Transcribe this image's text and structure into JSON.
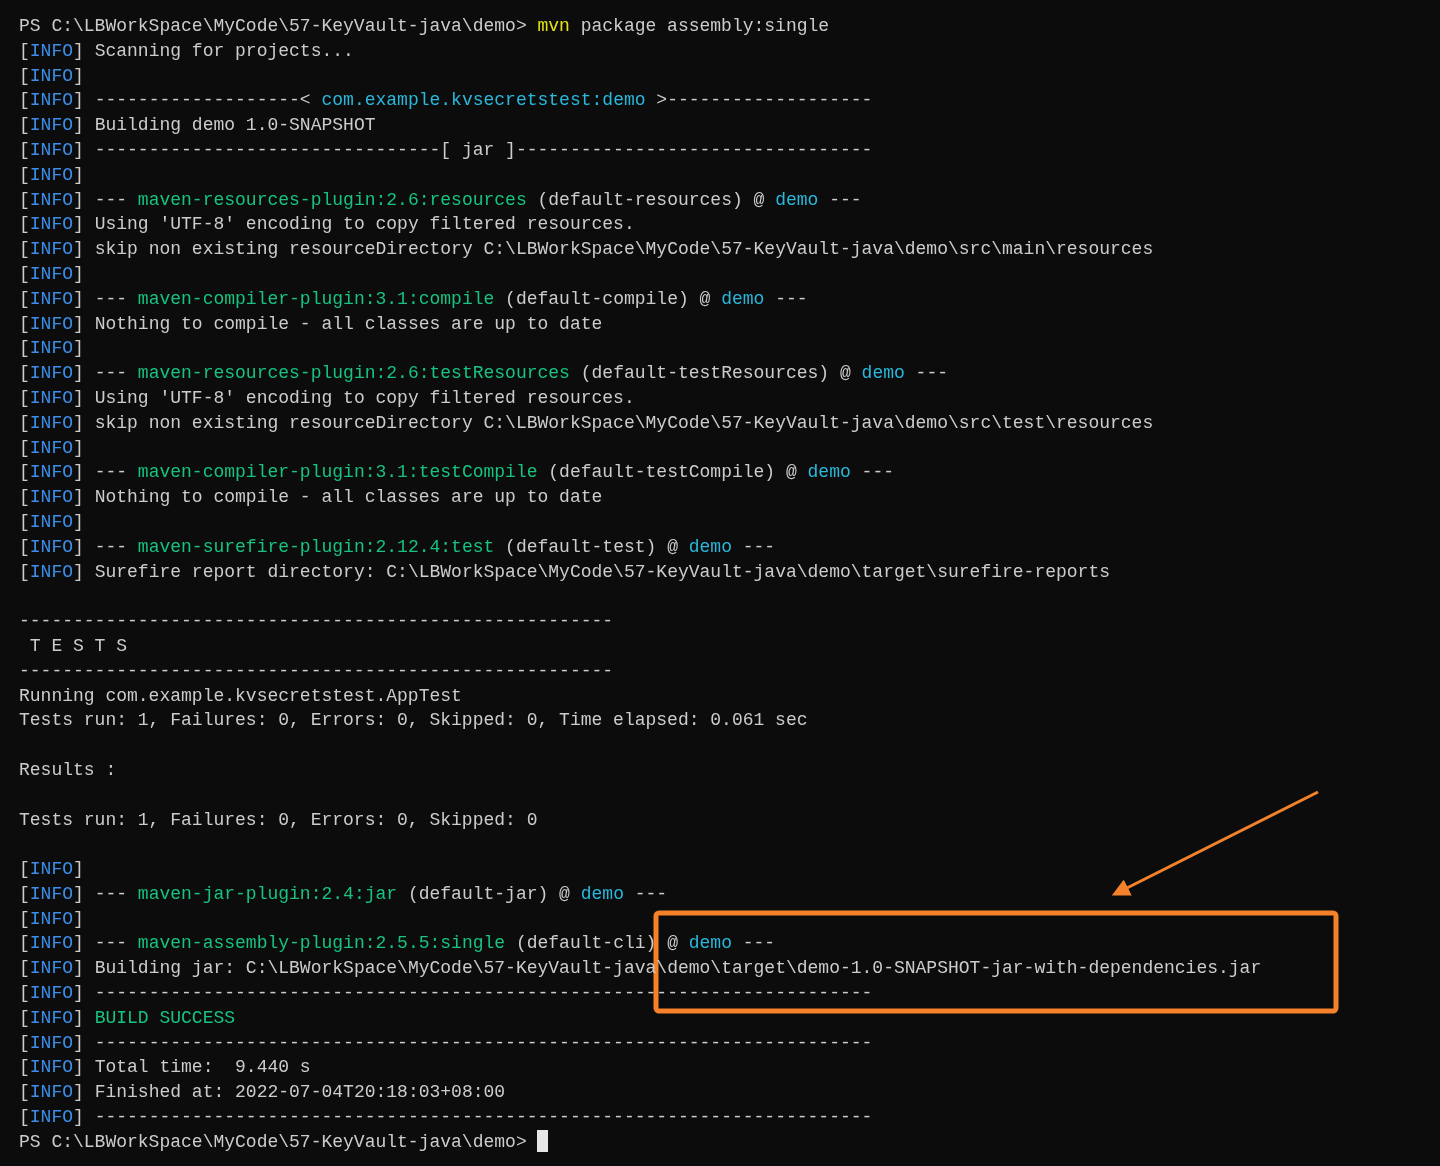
{
  "terminal": {
    "cursor": true,
    "blocks": [
      [
        [
          {
            "text": "PS C:\\LBWorkSpace\\MyCode\\57-KeyVault-java\\demo> ",
            "kind": "plain"
          },
          {
            "text": "mvn",
            "kind": "command"
          },
          {
            "text": " package assembly:single",
            "kind": "plain"
          }
        ],
        [
          {
            "text": "[",
            "kind": "plain"
          },
          {
            "text": "INFO",
            "kind": "tag"
          },
          {
            "text": "] Scanning for projects...",
            "kind": "plain"
          }
        ],
        [
          {
            "text": "[",
            "kind": "plain"
          },
          {
            "text": "INFO",
            "kind": "tag"
          },
          {
            "text": "]",
            "kind": "plain"
          }
        ],
        [
          {
            "text": "[",
            "kind": "plain"
          },
          {
            "text": "INFO",
            "kind": "tag"
          },
          {
            "text": "] -------------------< ",
            "kind": "plain"
          },
          {
            "text": "com.example.kvsecretstest:demo",
            "kind": "project"
          },
          {
            "text": " >-------------------",
            "kind": "plain"
          }
        ],
        [
          {
            "text": "[",
            "kind": "plain"
          },
          {
            "text": "INFO",
            "kind": "tag"
          },
          {
            "text": "] Building demo 1.0-SNAPSHOT",
            "kind": "plain"
          }
        ],
        [
          {
            "text": "[",
            "kind": "plain"
          },
          {
            "text": "INFO",
            "kind": "tag"
          },
          {
            "text": "] --------------------------------[ jar ]---------------------------------",
            "kind": "plain"
          }
        ],
        [
          {
            "text": "[",
            "kind": "plain"
          },
          {
            "text": "INFO",
            "kind": "tag"
          },
          {
            "text": "]",
            "kind": "plain"
          }
        ],
        [
          {
            "text": "[",
            "kind": "plain"
          },
          {
            "text": "INFO",
            "kind": "tag"
          },
          {
            "text": "] --- ",
            "kind": "plain"
          },
          {
            "text": "maven-resources-plugin:2.6:resources",
            "kind": "plugin"
          },
          {
            "text": " (default-resources) @ ",
            "kind": "plain"
          },
          {
            "text": "demo",
            "kind": "project"
          },
          {
            "text": " ---",
            "kind": "plain"
          }
        ],
        [
          {
            "text": "[",
            "kind": "plain"
          },
          {
            "text": "INFO",
            "kind": "tag"
          },
          {
            "text": "] Using 'UTF-8' encoding to copy filtered resources.",
            "kind": "plain"
          }
        ],
        [
          {
            "text": "[",
            "kind": "plain"
          },
          {
            "text": "INFO",
            "kind": "tag"
          },
          {
            "text": "] skip non existing resourceDirectory C:\\LBWorkSpace\\MyCode\\57-KeyVault-java\\demo\\src\\main\\resources",
            "kind": "plain"
          }
        ],
        [
          {
            "text": "[",
            "kind": "plain"
          },
          {
            "text": "INFO",
            "kind": "tag"
          },
          {
            "text": "]",
            "kind": "plain"
          }
        ],
        [
          {
            "text": "[",
            "kind": "plain"
          },
          {
            "text": "INFO",
            "kind": "tag"
          },
          {
            "text": "] --- ",
            "kind": "plain"
          },
          {
            "text": "maven-compiler-plugin:3.1:compile",
            "kind": "plugin"
          },
          {
            "text": " (default-compile) @ ",
            "kind": "plain"
          },
          {
            "text": "demo",
            "kind": "project"
          },
          {
            "text": " ---",
            "kind": "plain"
          }
        ],
        [
          {
            "text": "[",
            "kind": "plain"
          },
          {
            "text": "INFO",
            "kind": "tag"
          },
          {
            "text": "] Nothing to compile - all classes are up to date",
            "kind": "plain"
          }
        ],
        [
          {
            "text": "[",
            "kind": "plain"
          },
          {
            "text": "INFO",
            "kind": "tag"
          },
          {
            "text": "]",
            "kind": "plain"
          }
        ],
        [
          {
            "text": "[",
            "kind": "plain"
          },
          {
            "text": "INFO",
            "kind": "tag"
          },
          {
            "text": "] --- ",
            "kind": "plain"
          },
          {
            "text": "maven-resources-plugin:2.6:testResources",
            "kind": "plugin"
          },
          {
            "text": " (default-testResources) @ ",
            "kind": "plain"
          },
          {
            "text": "demo",
            "kind": "project"
          },
          {
            "text": " ---",
            "kind": "plain"
          }
        ],
        [
          {
            "text": "[",
            "kind": "plain"
          },
          {
            "text": "INFO",
            "kind": "tag"
          },
          {
            "text": "] Using 'UTF-8' encoding to copy filtered resources.",
            "kind": "plain"
          }
        ],
        [
          {
            "text": "[",
            "kind": "plain"
          },
          {
            "text": "INFO",
            "kind": "tag"
          },
          {
            "text": "] skip non existing resourceDirectory C:\\LBWorkSpace\\MyCode\\57-KeyVault-java\\demo\\src\\test\\resources",
            "kind": "plain"
          }
        ],
        [
          {
            "text": "[",
            "kind": "plain"
          },
          {
            "text": "INFO",
            "kind": "tag"
          },
          {
            "text": "]",
            "kind": "plain"
          }
        ],
        [
          {
            "text": "[",
            "kind": "plain"
          },
          {
            "text": "INFO",
            "kind": "tag"
          },
          {
            "text": "] --- ",
            "kind": "plain"
          },
          {
            "text": "maven-compiler-plugin:3.1:testCompile",
            "kind": "plugin"
          },
          {
            "text": " (default-testCompile) @ ",
            "kind": "plain"
          },
          {
            "text": "demo",
            "kind": "project"
          },
          {
            "text": " ---",
            "kind": "plain"
          }
        ],
        [
          {
            "text": "[",
            "kind": "plain"
          },
          {
            "text": "INFO",
            "kind": "tag"
          },
          {
            "text": "] Nothing to compile - all classes are up to date",
            "kind": "plain"
          }
        ],
        [
          {
            "text": "[",
            "kind": "plain"
          },
          {
            "text": "INFO",
            "kind": "tag"
          },
          {
            "text": "]",
            "kind": "plain"
          }
        ],
        [
          {
            "text": "[",
            "kind": "plain"
          },
          {
            "text": "INFO",
            "kind": "tag"
          },
          {
            "text": "] --- ",
            "kind": "plain"
          },
          {
            "text": "maven-surefire-plugin:2.12.4:test",
            "kind": "plugin"
          },
          {
            "text": " (default-test) @ ",
            "kind": "plain"
          },
          {
            "text": "demo",
            "kind": "project"
          },
          {
            "text": " ---",
            "kind": "plain"
          }
        ],
        [
          {
            "text": "[",
            "kind": "plain"
          },
          {
            "text": "INFO",
            "kind": "tag"
          },
          {
            "text": "] Surefire report directory: C:\\LBWorkSpace\\MyCode\\57-KeyVault-java\\demo\\target\\surefire-reports",
            "kind": "plain"
          }
        ]
      ],
      [
        [
          {
            "text": "-------------------------------------------------------",
            "kind": "plain"
          }
        ],
        [
          {
            "text": " T E S T S",
            "kind": "plain"
          }
        ],
        [
          {
            "text": "-------------------------------------------------------",
            "kind": "plain"
          }
        ],
        [
          {
            "text": "Running com.example.kvsecretstest.AppTest",
            "kind": "plain"
          }
        ],
        [
          {
            "text": "Tests run: 1, Failures: 0, Errors: 0, Skipped: 0, Time elapsed: 0.061 sec",
            "kind": "plain"
          }
        ]
      ],
      [
        [
          {
            "text": "Results :",
            "kind": "plain"
          }
        ]
      ],
      [
        [
          {
            "text": "Tests run: 1, Failures: 0, Errors: 0, Skipped: 0",
            "kind": "plain"
          }
        ]
      ],
      [
        [
          {
            "text": "[",
            "kind": "plain"
          },
          {
            "text": "INFO",
            "kind": "tag"
          },
          {
            "text": "]",
            "kind": "plain"
          }
        ],
        [
          {
            "text": "[",
            "kind": "plain"
          },
          {
            "text": "INFO",
            "kind": "tag"
          },
          {
            "text": "] --- ",
            "kind": "plain"
          },
          {
            "text": "maven-jar-plugin:2.4:jar",
            "kind": "plugin"
          },
          {
            "text": " (default-jar) @ ",
            "kind": "plain"
          },
          {
            "text": "demo",
            "kind": "project"
          },
          {
            "text": " ---",
            "kind": "plain"
          }
        ],
        [
          {
            "text": "[",
            "kind": "plain"
          },
          {
            "text": "INFO",
            "kind": "tag"
          },
          {
            "text": "]",
            "kind": "plain"
          }
        ],
        [
          {
            "text": "[",
            "kind": "plain"
          },
          {
            "text": "INFO",
            "kind": "tag"
          },
          {
            "text": "] --- ",
            "kind": "plain"
          },
          {
            "text": "maven-assembly-plugin:2.5.5:single",
            "kind": "plugin"
          },
          {
            "text": " (default-cli) @ ",
            "kind": "plain"
          },
          {
            "text": "demo",
            "kind": "project"
          },
          {
            "text": " ---",
            "kind": "plain"
          }
        ],
        [
          {
            "text": "[",
            "kind": "plain"
          },
          {
            "text": "INFO",
            "kind": "tag"
          },
          {
            "text": "] Building jar: C:\\LBWorkSpace\\MyCode\\57-KeyVault-java\\demo\\target\\demo-1.0-SNAPSHOT-jar-with-dependencies.jar",
            "kind": "plain"
          }
        ],
        [
          {
            "text": "[",
            "kind": "plain"
          },
          {
            "text": "INFO",
            "kind": "tag"
          },
          {
            "text": "] ------------------------------------------------------------------------",
            "kind": "plain"
          }
        ],
        [
          {
            "text": "[",
            "kind": "plain"
          },
          {
            "text": "INFO",
            "kind": "tag"
          },
          {
            "text": "] ",
            "kind": "plain"
          },
          {
            "text": "BUILD SUCCESS",
            "kind": "success"
          }
        ],
        [
          {
            "text": "[",
            "kind": "plain"
          },
          {
            "text": "INFO",
            "kind": "tag"
          },
          {
            "text": "] ------------------------------------------------------------------------",
            "kind": "plain"
          }
        ],
        [
          {
            "text": "[",
            "kind": "plain"
          },
          {
            "text": "INFO",
            "kind": "tag"
          },
          {
            "text": "] Total time:  9.440 s",
            "kind": "plain"
          }
        ],
        [
          {
            "text": "[",
            "kind": "plain"
          },
          {
            "text": "INFO",
            "kind": "tag"
          },
          {
            "text": "] Finished at: 2022-07-04T20:18:03+08:00",
            "kind": "plain"
          }
        ],
        [
          {
            "text": "[",
            "kind": "plain"
          },
          {
            "text": "INFO",
            "kind": "tag"
          },
          {
            "text": "] ------------------------------------------------------------------------",
            "kind": "plain"
          }
        ],
        [
          {
            "text": "PS C:\\LBWorkSpace\\MyCode\\57-KeyVault-java\\demo> ",
            "kind": "plain"
          }
        ]
      ]
    ]
  }
}
